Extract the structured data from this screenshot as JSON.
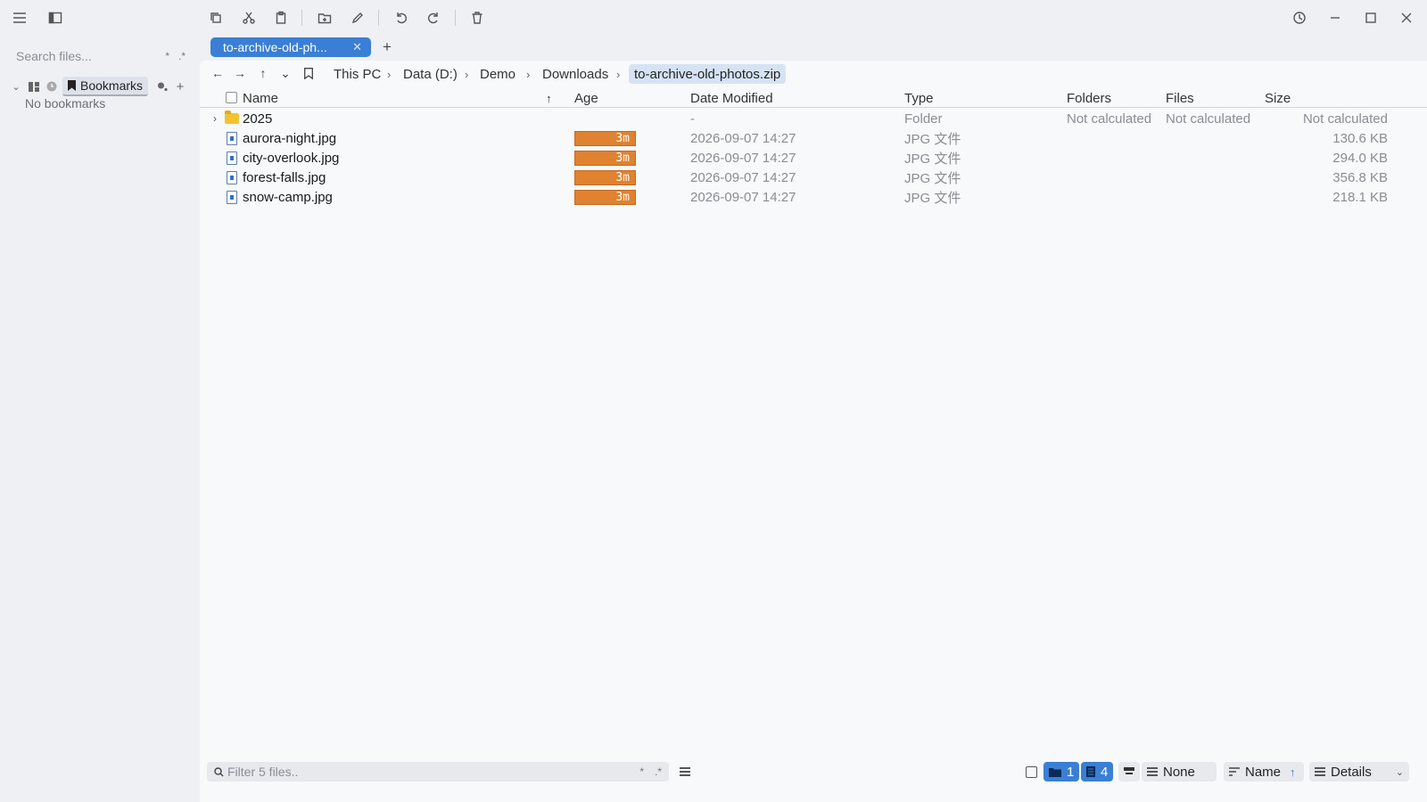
{
  "sidebar": {
    "search_placeholder": "Search files...",
    "search_wildcard": "*",
    "search_regex": ".*",
    "bookmarks_label": "Bookmarks",
    "empty_text": "No bookmarks"
  },
  "tabs": [
    {
      "label": "to-archive-old-ph...",
      "active": true
    }
  ],
  "breadcrumb": [
    "This PC",
    "Data (D:)",
    "Demo",
    "Downloads",
    "to-archive-old-photos.zip"
  ],
  "columns": {
    "name": "Name",
    "age": "Age",
    "date_modified": "Date Modified",
    "type": "Type",
    "folders": "Folders",
    "files": "Files",
    "size": "Size"
  },
  "rows": [
    {
      "name": "2025",
      "kind": "folder",
      "age": "",
      "date": "-",
      "type": "Folder",
      "folders": "Not calculated",
      "files": "Not calculated",
      "size": "Not calculated"
    },
    {
      "name": "aurora-night.jpg",
      "kind": "file",
      "age": "3m",
      "date": "2026-09-07 14:27",
      "type": "JPG 文件",
      "folders": "",
      "files": "",
      "size": "130.6 KB"
    },
    {
      "name": "city-overlook.jpg",
      "kind": "file",
      "age": "3m",
      "date": "2026-09-07 14:27",
      "type": "JPG 文件",
      "folders": "",
      "files": "",
      "size": "294.0 KB"
    },
    {
      "name": "forest-falls.jpg",
      "kind": "file",
      "age": "3m",
      "date": "2026-09-07 14:27",
      "type": "JPG 文件",
      "folders": "",
      "files": "",
      "size": "356.8 KB"
    },
    {
      "name": "snow-camp.jpg",
      "kind": "file",
      "age": "3m",
      "date": "2026-09-07 14:27",
      "type": "JPG 文件",
      "folders": "",
      "files": "",
      "size": "218.1 KB"
    }
  ],
  "statusbar": {
    "filter_placeholder": "Filter 5 files..",
    "filter_wildcard": "*",
    "filter_regex": ".*",
    "folder_count": "1",
    "file_count": "4",
    "group_by": "None",
    "sort_by": "Name",
    "view_mode": "Details"
  },
  "colors": {
    "accent": "#3a7fd5",
    "age_bar": "#e0822f",
    "folder": "#f2c230"
  }
}
